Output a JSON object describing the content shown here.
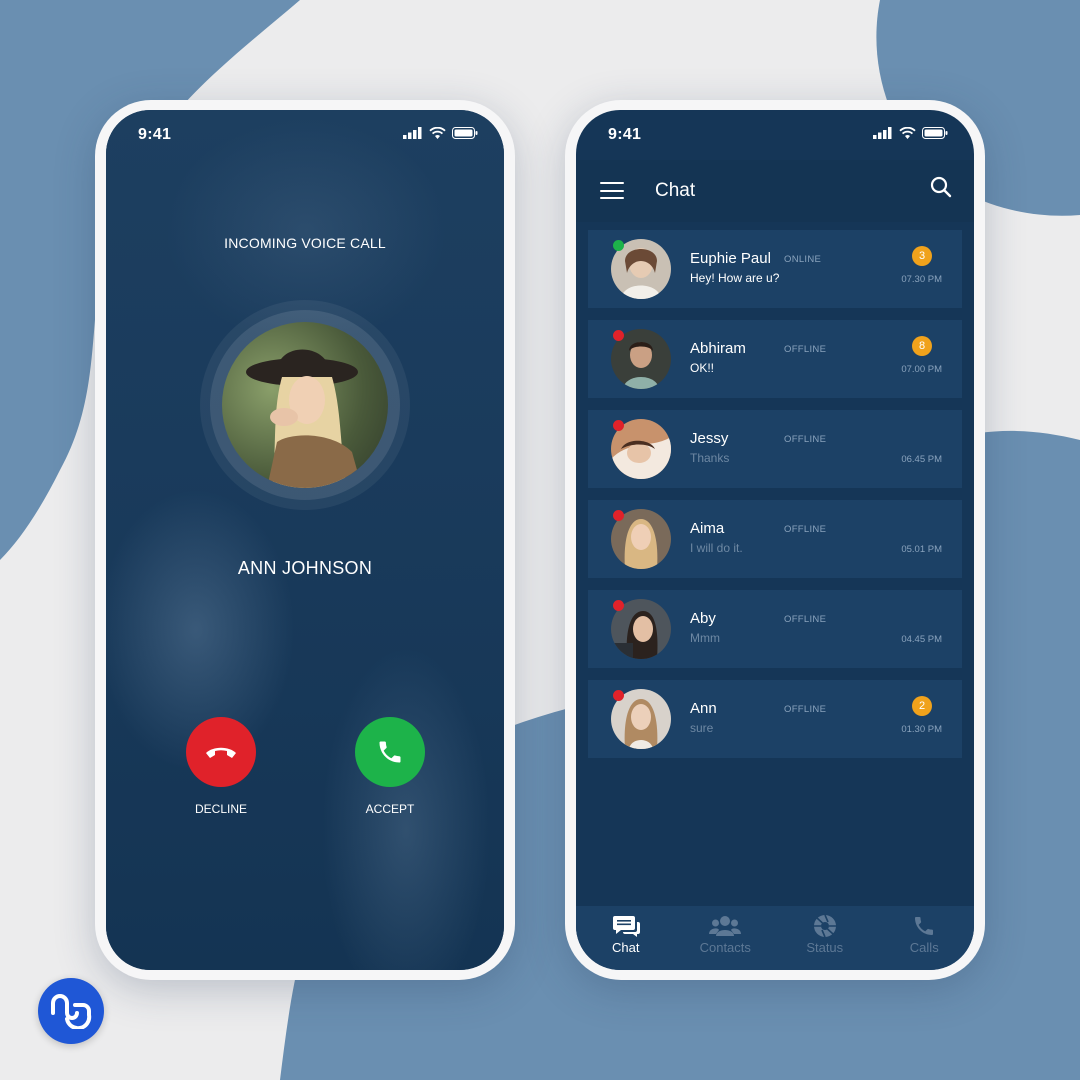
{
  "status_bar": {
    "time": "9:41"
  },
  "call_screen": {
    "label": "INCOMING VOICE CALL",
    "caller_name": "ANN JOHNSON",
    "decline_label": "DECLINE",
    "accept_label": "ACCEPT"
  },
  "chat_screen": {
    "title": "Chat",
    "chats": [
      {
        "name": "Euphie Paul",
        "status": "ONLINE",
        "message": "Hey! How are u?",
        "time": "07.30 PM",
        "unread": "3"
      },
      {
        "name": "Abhiram",
        "status": "OFFLINE",
        "message": "OK!!",
        "time": "07.00 PM",
        "unread": "8"
      },
      {
        "name": "Jessy",
        "status": "OFFLINE",
        "message": "Thanks",
        "time": "06.45 PM"
      },
      {
        "name": "Aima",
        "status": "OFFLINE",
        "message": "I will do it.",
        "time": "05.01 PM"
      },
      {
        "name": "Aby",
        "status": "OFFLINE",
        "message": "Mmm",
        "time": "04.45 PM"
      },
      {
        "name": "Ann",
        "status": "OFFLINE",
        "message": "sure",
        "time": "01.30 PM",
        "unread": "2"
      }
    ],
    "tabs": [
      {
        "label": "Chat",
        "icon": "chat-bubbles-icon",
        "active": true
      },
      {
        "label": "Contacts",
        "icon": "contacts-icon"
      },
      {
        "label": "Status",
        "icon": "aperture-icon"
      },
      {
        "label": "Calls",
        "icon": "phone-icon"
      }
    ]
  },
  "colors": {
    "screen_bg": "#153657",
    "card_bg": "#1c4166",
    "decline": "#e0222a",
    "accept": "#1db34a",
    "badge": "#f0a21c",
    "page_blob": "#6a8fb1",
    "logo": "#1f57d6"
  }
}
